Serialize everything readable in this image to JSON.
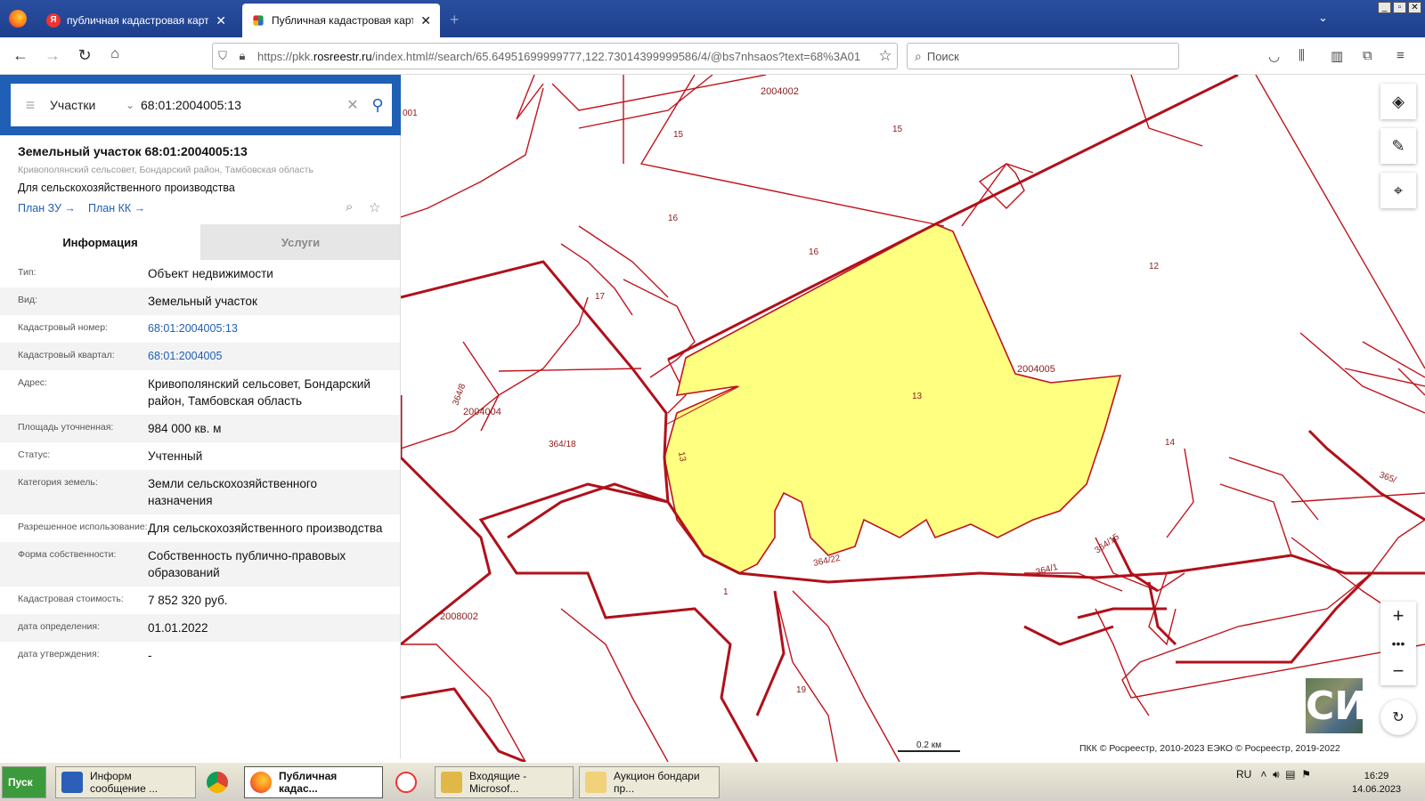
{
  "browser": {
    "tabs": [
      {
        "title": "публичная кадастровая карта —",
        "active": false
      },
      {
        "title": "Публичная кадастровая карта",
        "active": true
      }
    ],
    "url_prefix": "https://pkk.",
    "url_domain": "rosreestr.ru",
    "url_rest": "/index.html#/search/65.64951699999777,122.73014399999586/4/@bs7nhsaos?text=68%3A01",
    "search_placeholder": "Поиск"
  },
  "search": {
    "type_label": "Участки",
    "query": "68:01:2004005:13"
  },
  "parcel": {
    "title": "Земельный участок 68:01:2004005:13",
    "address_short": "Кривополянский сельсовет, Бондарский район, Тамбовская область",
    "usage": "Для сельскохозяйственного производства",
    "link_plan_zu": "План ЗУ →",
    "link_plan_kk": "План КК →",
    "tab_info": "Информация",
    "tab_services": "Услуги",
    "rows": [
      {
        "k": "Тип:",
        "v": "Объект недвижимости"
      },
      {
        "k": "Вид:",
        "v": "Земельный участок"
      },
      {
        "k": "Кадастровый номер:",
        "v": "68:01:2004005:13"
      },
      {
        "k": "Кадастровый квартал:",
        "v": "68:01:2004005"
      },
      {
        "k": "Адрес:",
        "v": "Кривополянский сельсовет, Бондарский район, Тамбовская область"
      },
      {
        "k": "Площадь уточненная:",
        "v": "984 000 кв. м"
      },
      {
        "k": "Статус:",
        "v": "Учтенный"
      },
      {
        "k": "Категория земель:",
        "v": "Земли сельскохозяйственного назначения"
      },
      {
        "k": "Разрешенное использование:",
        "v": "Для сельскохозяйственного производства"
      },
      {
        "k": "Форма собственности:",
        "v": "Собственность публично-правовых образований"
      },
      {
        "k": "Кадастровая стоимость:",
        "v": "7 852 320 руб."
      },
      {
        "k": "дата определения:",
        "v": "01.01.2022"
      },
      {
        "k": "дата утверждения:",
        "v": "-"
      }
    ]
  },
  "map": {
    "labels": {
      "q2004002": "2004002",
      "q2004005": "2004005",
      "q2004004": "2004004",
      "q2008002": "2008002",
      "l15a": "15",
      "l15b": "15",
      "l16a": "16",
      "l16b": "16",
      "l17": "17",
      "l12": "12",
      "l13": "13",
      "l13b": "13",
      "l14": "14",
      "l1": "1",
      "l19": "19",
      "l364_8": "364/8",
      "l364_18": "364/18",
      "l364_22": "364/22",
      "l364_1": "364/1",
      "l364_15": "364/15",
      "l365": "365/",
      "l001": "001"
    },
    "scale_label": "0.2 км",
    "copyright": "ПКК © Росреестр, 2010-2023 ЕЭКО © Росреестр, 2019-2022",
    "minimap_text": "СИ",
    "highlight_color": "#ffff80",
    "boundary_color": "#c0141c"
  },
  "taskbar": {
    "start": "Пуск",
    "items": [
      "Информ сообщение ...",
      "Публичная кадас...",
      "Входящие - Microsof...",
      "Аукцион бондари пр..."
    ],
    "lang": "RU",
    "time": "16:29",
    "date": "14.06.2023"
  }
}
